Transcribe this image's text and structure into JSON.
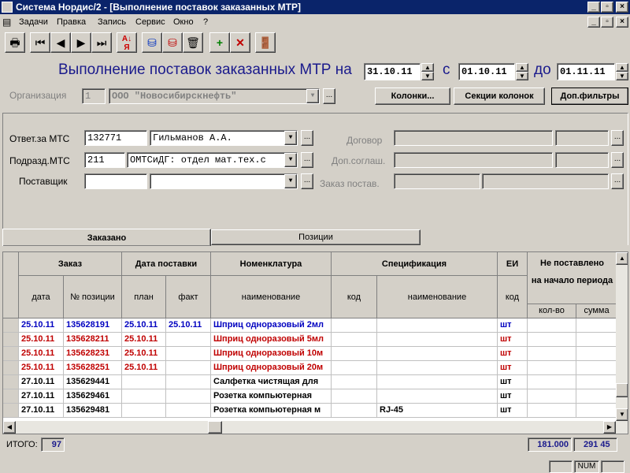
{
  "window": {
    "title": "Система Нордис/2 - [Выполнение поставок заказанных МТР]",
    "min": "_",
    "max": "▫",
    "close": "×"
  },
  "menu": [
    "Задачи",
    "Правка",
    "Запись",
    "Сервис",
    "Окно",
    "?"
  ],
  "toolbar_icons": [
    "printer-icon",
    "first-icon",
    "prev-icon",
    "next-icon",
    "last-icon",
    "sort-icon",
    "db-down-icon",
    "db-up-icon",
    "recycle-icon",
    "add-doc-icon",
    "delete-doc-icon",
    "exit-icon"
  ],
  "header": {
    "title": "Выполнение поставок заказанных МТР на",
    "date_on": "31.10.11",
    "from_label": "с",
    "date_from": "01.10.11",
    "to_label": "до",
    "date_to": "01.11.11"
  },
  "org": {
    "label": "Организация",
    "code": "1",
    "name": "ООО \"Новосибирскнефть\""
  },
  "buttons": {
    "columns": "Колонки...",
    "column_sections": "Секции колонок",
    "extra_filters": "Доп.фильтры"
  },
  "filters": {
    "responsible_label": "Ответ.за МТС",
    "responsible_code": "132771",
    "responsible_name": "Гильманов А.А.",
    "dept_label": "Подразд.МТС",
    "dept_code": "211",
    "dept_name": "ОМТСиДГ: отдел мат.тех.с",
    "supplier_label": "Поставщик",
    "supplier_code": "",
    "supplier_name": "",
    "contract_label": "Договор",
    "addendum_label": "Доп.соглаш.",
    "supplier_order_label": "Заказ постав."
  },
  "tabs": [
    "Заказано",
    "Позиции"
  ],
  "grid": {
    "group_headers": [
      "Заказ",
      "Дата поставки",
      "Номенклатура",
      "Спецификация",
      "ЕИ",
      "Не поставлено",
      "на начало периода"
    ],
    "sub_headers": [
      "дата",
      "№ позиции",
      "план",
      "факт",
      "наименование",
      "код",
      "наименование",
      "код",
      "кол-во",
      "сумма"
    ],
    "rows": [
      {
        "color": "#0000c0",
        "date": "25.10.11",
        "pos": "135628191",
        "plan": "25.10.11",
        "fact": "25.10.11",
        "name": "Шприц одноразовый 2мл",
        "spec_code": "",
        "spec_name": "",
        "unit": "шт"
      },
      {
        "color": "#c00000",
        "date": "25.10.11",
        "pos": "135628211",
        "plan": "25.10.11",
        "fact": "",
        "name": "Шприц одноразовый 5мл",
        "spec_code": "",
        "spec_name": "",
        "unit": "шт"
      },
      {
        "color": "#c00000",
        "date": "25.10.11",
        "pos": "135628231",
        "plan": "25.10.11",
        "fact": "",
        "name": "Шприц одноразовый 10м",
        "spec_code": "",
        "spec_name": "",
        "unit": "шт"
      },
      {
        "color": "#c00000",
        "date": "25.10.11",
        "pos": "135628251",
        "plan": "25.10.11",
        "fact": "",
        "name": "Шприц одноразовый 20м",
        "spec_code": "",
        "spec_name": "",
        "unit": "шт"
      },
      {
        "color": "#000000",
        "date": "27.10.11",
        "pos": "135629441",
        "plan": "",
        "fact": "",
        "name": "Салфетка чистящая для",
        "spec_code": "",
        "spec_name": "",
        "unit": "шт"
      },
      {
        "color": "#000000",
        "date": "27.10.11",
        "pos": "135629461",
        "plan": "",
        "fact": "",
        "name": "Розетка компьютерная",
        "spec_code": "",
        "spec_name": "",
        "unit": "шт"
      },
      {
        "color": "#000000",
        "date": "27.10.11",
        "pos": "135629481",
        "plan": "",
        "fact": "",
        "name": "Розетка компьютерная м",
        "spec_code": "",
        "spec_name": "RJ-45",
        "unit": "шт"
      }
    ]
  },
  "status": {
    "total_label": "ИТОГО:",
    "total_count": "97",
    "qty_total": "181.000",
    "sum_total": "291 45",
    "num": "NUM"
  },
  "colors": {
    "title_blue": "#0a246a",
    "header_text": "#1a1a8c"
  }
}
